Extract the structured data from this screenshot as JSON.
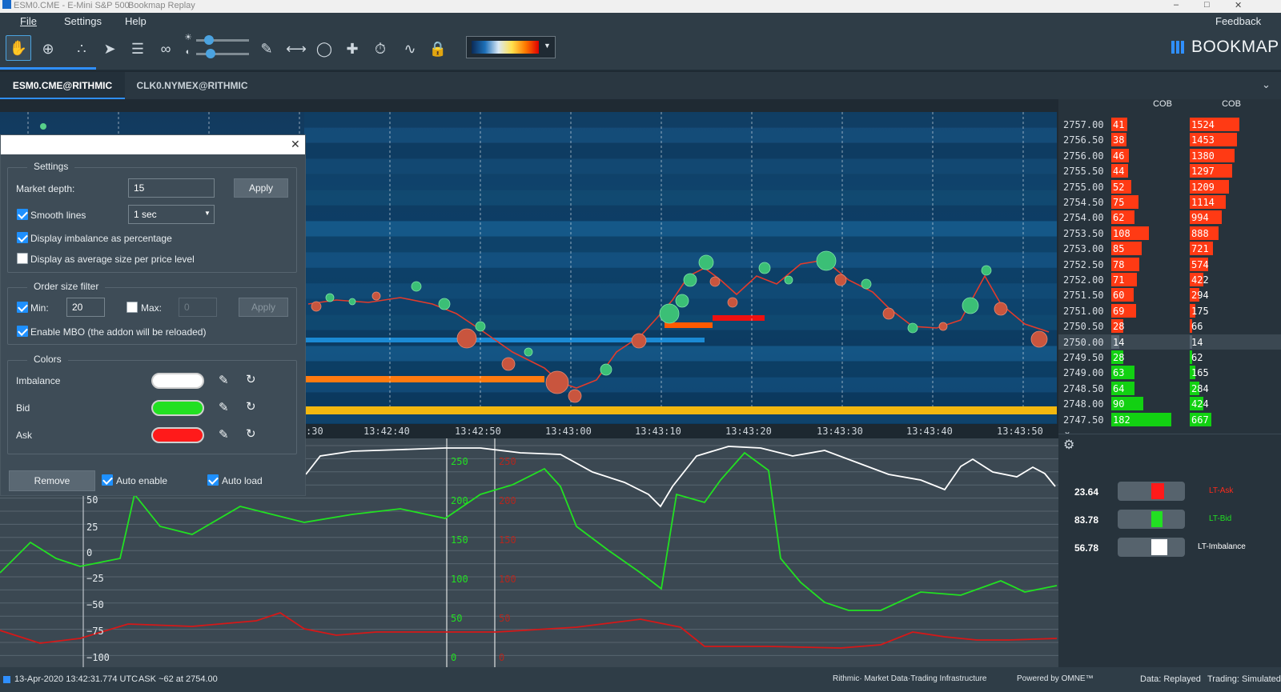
{
  "window": {
    "title": "ESM0.CME - E-Mini S&P 500",
    "subtitle": "Bookmap Replay"
  },
  "menu": {
    "file": "File",
    "settings": "Settings",
    "help": "Help",
    "feedback": "Feedback"
  },
  "brand": {
    "name": "BOOKMAP"
  },
  "tabs": [
    {
      "label": "ESM0.CME@RITHMIC",
      "active": true
    },
    {
      "label": "CLK0.NYMEX@RITHMIC",
      "active": false
    }
  ],
  "toolbar_icons": [
    "hand-icon",
    "zoom-target-icon",
    "share-icon",
    "rocket-icon",
    "layers-icon",
    "link-icon",
    "brightness-icon",
    "contrast-icon",
    "pencil-icon",
    "ruler-icon",
    "chat-icon",
    "crosshair-icon",
    "stopwatch-icon",
    "indicator-icon",
    "lock-icon"
  ],
  "time_axis": [
    ":30",
    "13:42:40",
    "13:42:50",
    "13:43:00",
    "13:43:10",
    "13:43:20",
    "13:43:30",
    "13:43:40",
    "13:43:50"
  ],
  "order_book": {
    "col1_header": "COB",
    "col2_header": "COB",
    "rows": [
      {
        "price": "2757.00",
        "v1": "41",
        "v2": "1524",
        "side": "ask"
      },
      {
        "price": "2756.50",
        "v1": "38",
        "v2": "1453",
        "side": "ask"
      },
      {
        "price": "2756.00",
        "v1": "46",
        "v2": "1380",
        "side": "ask"
      },
      {
        "price": "2755.50",
        "v1": "44",
        "v2": "1297",
        "side": "ask"
      },
      {
        "price": "2755.00",
        "v1": "52",
        "v2": "1209",
        "side": "ask"
      },
      {
        "price": "2754.50",
        "v1": "75",
        "v2": "1114",
        "side": "ask"
      },
      {
        "price": "2754.00",
        "v1": "62",
        "v2": "994",
        "side": "ask"
      },
      {
        "price": "2753.50",
        "v1": "108",
        "v2": "888",
        "side": "ask"
      },
      {
        "price": "2753.00",
        "v1": "85",
        "v2": "721",
        "side": "ask"
      },
      {
        "price": "2752.50",
        "v1": "78",
        "v2": "574",
        "side": "ask"
      },
      {
        "price": "2752.00",
        "v1": "71",
        "v2": "422",
        "side": "ask"
      },
      {
        "price": "2751.50",
        "v1": "60",
        "v2": "294",
        "side": "ask"
      },
      {
        "price": "2751.00",
        "v1": "69",
        "v2": "175",
        "side": "ask"
      },
      {
        "price": "2750.50",
        "v1": "28",
        "v2": "66",
        "side": "ask"
      },
      {
        "price": "2750.00",
        "v1": "14",
        "v2": "14",
        "side": "mid"
      },
      {
        "price": "2749.50",
        "v1": "28",
        "v2": "62",
        "side": "bid"
      },
      {
        "price": "2749.00",
        "v1": "63",
        "v2": "165",
        "side": "bid"
      },
      {
        "price": "2748.50",
        "v1": "64",
        "v2": "284",
        "side": "bid"
      },
      {
        "price": "2748.00",
        "v1": "90",
        "v2": "424",
        "side": "bid"
      },
      {
        "price": "2747.50",
        "v1": "182",
        "v2": "667",
        "side": "bid"
      }
    ]
  },
  "lt_indicators": [
    {
      "value": "23.64",
      "label": "LT-Ask",
      "color": "#ff2a1a"
    },
    {
      "value": "83.78",
      "label": "LT-Bid",
      "color": "#22e022"
    },
    {
      "value": "56.78",
      "label": "LT-Imbalance",
      "color": "#ffffff"
    }
  ],
  "lower_axis_left": [
    "50",
    "25",
    "0",
    "−25",
    "−50",
    "−75",
    "−100"
  ],
  "lower_axis_mid": [
    "250",
    "200",
    "150",
    "100",
    "50",
    "0"
  ],
  "dialog": {
    "settings_title": "Settings",
    "market_depth_label": "Market depth:",
    "market_depth_value": "15",
    "apply_label": "Apply",
    "smooth_lines_label": "Smooth lines",
    "smooth_interval": "1 sec",
    "imbalance_pct_label": "Display imbalance as percentage",
    "avg_size_label": "Display as average size per price level",
    "order_filter_title": "Order size filter",
    "min_label": "Min:",
    "min_value": "20",
    "max_label": "Max:",
    "max_value": "0",
    "apply2_label": "Apply",
    "mbo_label": "Enable MBO (the addon will be reloaded)",
    "colors_title": "Colors",
    "color_rows": [
      {
        "label": "Imbalance",
        "color": "#ffffff"
      },
      {
        "label": "Bid",
        "color": "#22e022"
      },
      {
        "label": "Ask",
        "color": "#ff1a1a"
      }
    ],
    "remove_label": "Remove",
    "auto_enable_label": "Auto enable",
    "auto_load_label": "Auto load"
  },
  "status": {
    "datetime": "13-Apr-2020 13:42:31.774 UTC",
    "ask_info": "ASK ~62 at 2754.00",
    "rithmic": "Rithmic· Market Data·Trading Infrastructure",
    "omne": "Powered by OMNE™",
    "data_mode": "Data: Replayed",
    "trading_mode": "Trading: Simulated"
  }
}
